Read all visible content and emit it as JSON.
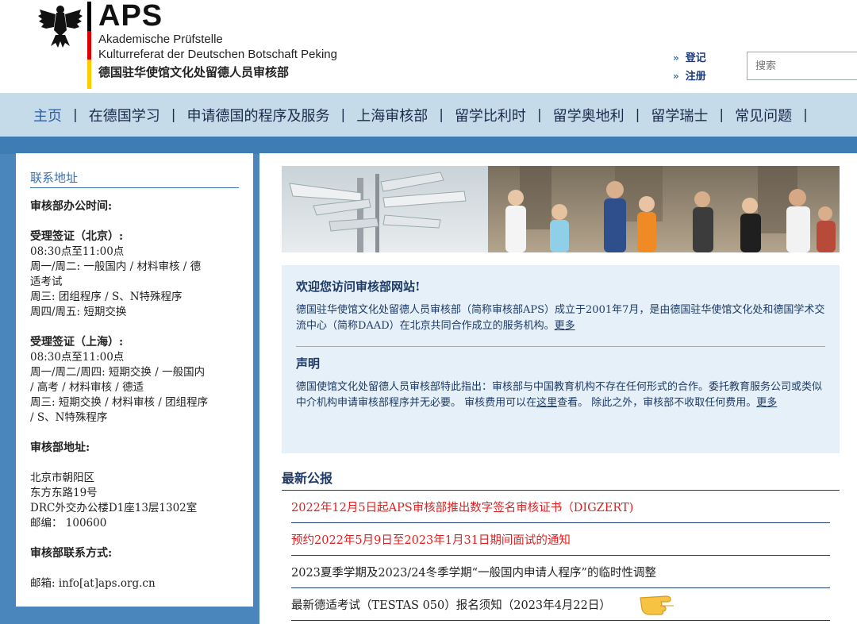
{
  "header": {
    "brand_aps": "APS",
    "brand_line1": "Akademische Prüfstelle",
    "brand_line2": "Kulturreferat der Deutschen Botschaft Peking",
    "brand_cn": "德国驻华使馆文化处留德人员审核部",
    "flag_colors": [
      "#000000",
      "#dd0000",
      "#ffcc00"
    ],
    "login_label": "登记",
    "register_label": "注册",
    "link_arrow": "»",
    "search_placeholder": "搜索"
  },
  "nav": {
    "items": [
      {
        "label": "主页"
      },
      {
        "label": "在德国学习"
      },
      {
        "label": "申请德国的程序及服务"
      },
      {
        "label": "上海审核部"
      },
      {
        "label": "留学比利时"
      },
      {
        "label": "留学奥地利"
      },
      {
        "label": "留学瑞士"
      },
      {
        "label": "常见问题"
      }
    ],
    "separator": "|"
  },
  "sidebar": {
    "title": "联系地址",
    "office_hours_head": "审核部办公时间:",
    "beijing_head": "受理签证（北京）:",
    "beijing_lines": [
      "08:30点至11:00点",
      "周一/周二: 一般国内 / 材料审核 / 德",
      "适考试",
      "周三: 团组程序 / S、N特殊程序"
    ],
    "beijing_last": "周四/周五: 短期交换",
    "shanghai_head": "受理签证（上海）:",
    "shanghai_lines": [
      "08:30点至11:00点",
      "周一/周二/周四: 短期交换 / 一般国内",
      "/ 高考 / 材料审核 / 德适",
      "周三: 短期交换 / 材料审核 / 团组程序",
      "/ S、N特殊程序"
    ],
    "address_head": "审核部地址:",
    "address_lines": [
      "北京市朝阳区",
      "东方东路19号",
      "DRC外交办公楼D1座13层1302室",
      "邮编： 100600"
    ],
    "contact_head": "审核部联系方式:",
    "email": "邮箱: info[at]aps.org.cn"
  },
  "welcome": {
    "title": "欢迎您访问审核部网站!",
    "text": "德国驻华使馆文化处留德人员审核部（简称审核部APS）成立于2001年7月，是由德国驻华使馆文化处和德国学术交流中心（简称DAAD）在北京共同合作成立的服务机构。",
    "more1": "更多",
    "notice_title": "声明",
    "notice_text_1": "德国使馆文化处留德人员审核部特此指出：审核部与中国教育机构不存在任何形式的合作。委托教育服务公司或类似中介机构申请审核部程序并无必要。 审核费用可以在",
    "notice_link": "这里",
    "notice_text_2": "查看。 除此之外，审核部不收取任何费用。",
    "more2": "更多"
  },
  "news": {
    "title": "最新公报",
    "items": [
      {
        "text": "2022年12月5日起APS审核部推出数字签名审核证书（DIGZERT)"
      },
      {
        "text": "预约2022年5月9日至2023年1月31日期间面试的通知"
      },
      {
        "text": "2023夏季学期及2023/24冬季学期“一般国内申请人程序”的临时性调整"
      },
      {
        "text": "最新德适考试（TESTAS 050）报名须知（2023年4月22日）"
      }
    ]
  },
  "colors": {
    "nav_bg": "#c5dbea",
    "page_bg": "#4a86bb",
    "accent": "#2e5fa3",
    "news_red": "#e02020"
  }
}
